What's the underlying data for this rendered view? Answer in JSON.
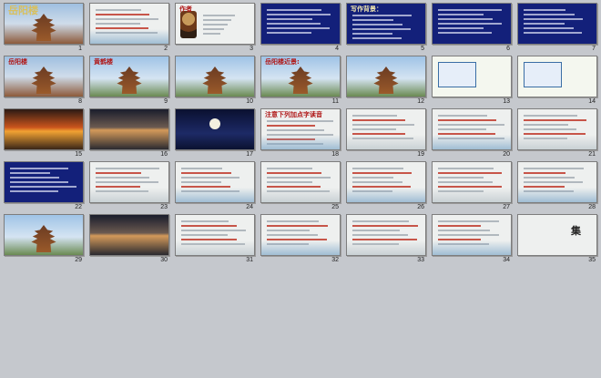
{
  "window": {
    "title": ""
  },
  "slides": [
    {
      "num": "1",
      "title": "岳阳楼",
      "style": "title-photo"
    },
    {
      "num": "2",
      "title": "",
      "style": "paper-text"
    },
    {
      "num": "3",
      "title": "作者",
      "style": "author"
    },
    {
      "num": "4",
      "title": "",
      "style": "navy-text"
    },
    {
      "num": "5",
      "title": "写作背景：",
      "style": "navy-text"
    },
    {
      "num": "6",
      "title": "",
      "style": "navy-text"
    },
    {
      "num": "7",
      "title": "",
      "style": "navy-text"
    },
    {
      "num": "8",
      "title": "岳阳楼",
      "style": "photo-red"
    },
    {
      "num": "9",
      "title": "黄鹤楼",
      "style": "photo-sky"
    },
    {
      "num": "10",
      "title": "",
      "style": "photo-sky"
    },
    {
      "num": "11",
      "title": "岳阳楼近景:",
      "style": "photo-sky"
    },
    {
      "num": "12",
      "title": "",
      "style": "photo-sky"
    },
    {
      "num": "13",
      "title": "",
      "style": "map"
    },
    {
      "num": "14",
      "title": "",
      "style": "map"
    },
    {
      "num": "15",
      "title": "",
      "style": "sunset"
    },
    {
      "num": "16",
      "title": "",
      "style": "dusk"
    },
    {
      "num": "17",
      "title": "",
      "style": "night"
    },
    {
      "num": "18",
      "title": "注意下列加点字读音",
      "style": "paper-text"
    },
    {
      "num": "19",
      "title": "",
      "style": "paper-text"
    },
    {
      "num": "20",
      "title": "",
      "style": "paper-text"
    },
    {
      "num": "21",
      "title": "",
      "style": "paper-text"
    },
    {
      "num": "22",
      "title": "",
      "style": "navy-text"
    },
    {
      "num": "23",
      "title": "",
      "style": "paper-text"
    },
    {
      "num": "24",
      "title": "",
      "style": "paper-text"
    },
    {
      "num": "25",
      "title": "",
      "style": "paper-text"
    },
    {
      "num": "26",
      "title": "",
      "style": "paper-text"
    },
    {
      "num": "27",
      "title": "",
      "style": "paper-text"
    },
    {
      "num": "28",
      "title": "",
      "style": "paper-text"
    },
    {
      "num": "29",
      "title": "",
      "style": "photo-sky"
    },
    {
      "num": "30",
      "title": "",
      "style": "dusk"
    },
    {
      "num": "31",
      "title": "",
      "style": "paper-text"
    },
    {
      "num": "32",
      "title": "",
      "style": "paper-text"
    },
    {
      "num": "33",
      "title": "",
      "style": "paper-text"
    },
    {
      "num": "34",
      "title": "",
      "style": "paper-text"
    },
    {
      "num": "35",
      "title": "集",
      "style": "calligraphy"
    }
  ]
}
